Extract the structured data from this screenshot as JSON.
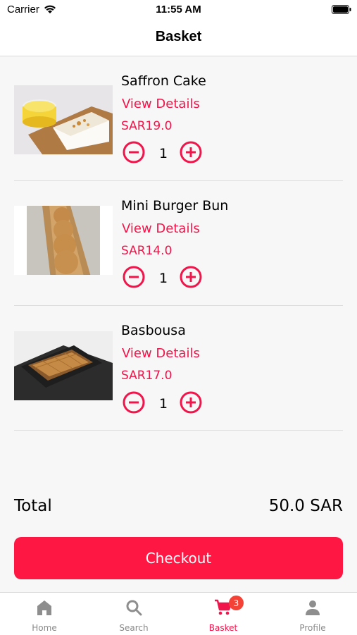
{
  "status_bar": {
    "carrier": "Carrier",
    "time": "11:55 AM"
  },
  "header": {
    "title": "Basket"
  },
  "basket": {
    "items": [
      {
        "name": "Saffron Cake",
        "details_label": "View Details",
        "price": "SAR19.0",
        "quantity": "1"
      },
      {
        "name": "Mini Burger Bun",
        "details_label": "View Details",
        "price": "SAR14.0",
        "quantity": "1"
      },
      {
        "name": "Basbousa",
        "details_label": "View Details",
        "price": "SAR17.0",
        "quantity": "1"
      }
    ]
  },
  "summary": {
    "total_label": "Total",
    "total_value": "50.0 SAR"
  },
  "checkout": {
    "label": "Checkout"
  },
  "tabbar": {
    "tabs": [
      {
        "label": "Home",
        "icon": "home-icon"
      },
      {
        "label": "Search",
        "icon": "search-icon"
      },
      {
        "label": "Basket",
        "icon": "cart-icon",
        "badge": "3",
        "active": true
      },
      {
        "label": "Profile",
        "icon": "profile-icon"
      }
    ]
  },
  "colors": {
    "accent": "#f0154a",
    "button": "#ff1744",
    "badge": "#f44336"
  }
}
